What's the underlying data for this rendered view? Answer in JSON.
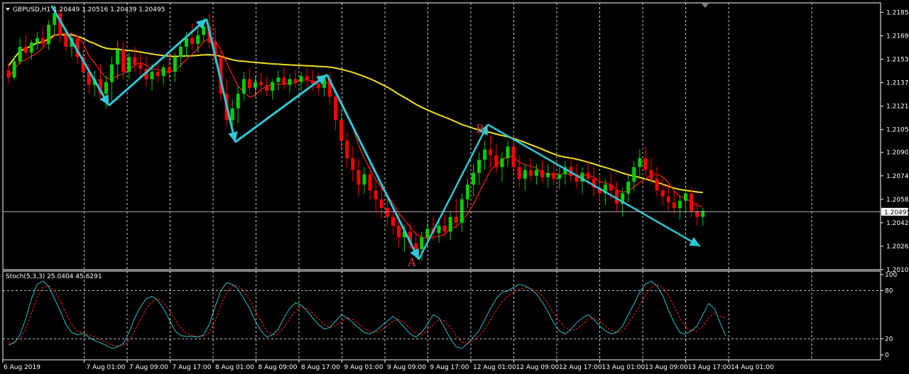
{
  "header": {
    "symbol_tf": "GBPUSD,H1",
    "ohlc": "1.20449 1.20516 1.20439 1.20495"
  },
  "stoch_header": {
    "label": "Stoch(5,3,3) 25.0404 45.6291"
  },
  "colors": {
    "background": "#000000",
    "grid": "#ffffff",
    "bull_candle": "#00d000",
    "bear_candle": "#ff0000",
    "fast_ma": "#ff2020",
    "slow_ma": "#f0e020",
    "arrows": "#2fc8d8",
    "stoch_main": "#30c0c8",
    "stoch_signal": "#ff2020",
    "price_line": "#b0b0b0"
  },
  "annotations": {
    "point_a": "A",
    "point_b": "B"
  },
  "chart_data": [
    {
      "type": "candlestick",
      "title": "",
      "price_axis_ticks": [
        "1.21855",
        "1.21695",
        "1.21535",
        "1.21375",
        "1.21215",
        "1.21055",
        "1.20900",
        "1.20740",
        "1.20580",
        "1.20420",
        "1.20260",
        "1.20100"
      ],
      "current_price": "1.20495",
      "ylim": [
        1.201,
        1.2192
      ],
      "time_axis_ticks": [
        "6 Aug 2019",
        "7 Aug 01:00",
        "7 Aug 09:00",
        "7 Aug 17:00",
        "8 Aug 01:00",
        "8 Aug 09:00",
        "8 Aug 17:00",
        "9 Aug 01:00",
        "9 Aug 09:00",
        "9 Aug 17:00",
        "12 Aug 01:00",
        "12 Aug 09:00",
        "12 Aug 17:00",
        "13 Aug 01:00",
        "13 Aug 09:00",
        "13 Aug 17:00",
        "14 Aug 01:00"
      ],
      "trend_arrows": [
        {
          "from": {
            "bar": 8,
            "price": 1.219
          },
          "to": {
            "bar": 18,
            "price": 1.2122
          }
        },
        {
          "from": {
            "bar": 18,
            "price": 1.2122
          },
          "to": {
            "bar": 35,
            "price": 1.2181
          }
        },
        {
          "from": {
            "bar": 35,
            "price": 1.2181
          },
          "to": {
            "bar": 40,
            "price": 1.2097
          }
        },
        {
          "from": {
            "bar": 40,
            "price": 1.2097
          },
          "to": {
            "bar": 56,
            "price": 1.2143
          }
        },
        {
          "from": {
            "bar": 56,
            "price": 1.2143
          },
          "to": {
            "bar": 72,
            "price": 1.2017
          }
        },
        {
          "from": {
            "bar": 72,
            "price": 1.2017
          },
          "to": {
            "bar": 84,
            "price": 1.2109
          }
        },
        {
          "from": {
            "bar": 84,
            "price": 1.2109
          },
          "to": {
            "bar": 121,
            "price": 1.2026
          }
        }
      ],
      "candles": [
        [
          1.2146,
          1.2151,
          1.2137,
          1.2141
        ],
        [
          1.2141,
          1.2156,
          1.2139,
          1.2152
        ],
        [
          1.2152,
          1.2168,
          1.215,
          1.2162
        ],
        [
          1.2162,
          1.217,
          1.2155,
          1.2158
        ],
        [
          1.2158,
          1.2167,
          1.2153,
          1.2165
        ],
        [
          1.2165,
          1.2172,
          1.216,
          1.2168
        ],
        [
          1.2168,
          1.2175,
          1.2162,
          1.2164
        ],
        [
          1.2164,
          1.218,
          1.216,
          1.2177
        ],
        [
          1.2177,
          1.219,
          1.217,
          1.2185
        ],
        [
          1.2185,
          1.2188,
          1.2165,
          1.217
        ],
        [
          1.217,
          1.2175,
          1.2158,
          1.2162
        ],
        [
          1.2162,
          1.2172,
          1.2155,
          1.2168
        ],
        [
          1.2168,
          1.217,
          1.215,
          1.2155
        ],
        [
          1.2155,
          1.216,
          1.214,
          1.2145
        ],
        [
          1.2145,
          1.215,
          1.213,
          1.2136
        ],
        [
          1.2136,
          1.2146,
          1.2128,
          1.214
        ],
        [
          1.214,
          1.215,
          1.2125,
          1.213
        ],
        [
          1.213,
          1.2142,
          1.212,
          1.2138
        ],
        [
          1.2138,
          1.2155,
          1.2125,
          1.215
        ],
        [
          1.215,
          1.2166,
          1.214,
          1.216
        ],
        [
          1.216,
          1.2165,
          1.214,
          1.2145
        ],
        [
          1.2145,
          1.2158,
          1.214,
          1.2155
        ],
        [
          1.2155,
          1.2162,
          1.2145,
          1.215
        ],
        [
          1.215,
          1.2158,
          1.2142,
          1.2147
        ],
        [
          1.2147,
          1.2155,
          1.2135,
          1.214
        ],
        [
          1.214,
          1.215,
          1.2132,
          1.2145
        ],
        [
          1.2145,
          1.2152,
          1.2138,
          1.2142
        ],
        [
          1.2142,
          1.215,
          1.2136,
          1.2148
        ],
        [
          1.2148,
          1.2158,
          1.214,
          1.2145
        ],
        [
          1.2145,
          1.2158,
          1.2138,
          1.2155
        ],
        [
          1.2155,
          1.2166,
          1.2148,
          1.2162
        ],
        [
          1.2162,
          1.2172,
          1.2155,
          1.2168
        ],
        [
          1.2168,
          1.2178,
          1.216,
          1.2164
        ],
        [
          1.2164,
          1.2175,
          1.2158,
          1.217
        ],
        [
          1.217,
          1.2182,
          1.2165,
          1.2176
        ],
        [
          1.2176,
          1.2185,
          1.2162,
          1.2165
        ],
        [
          1.2165,
          1.2175,
          1.215,
          1.2155
        ],
        [
          1.2155,
          1.216,
          1.2125,
          1.213
        ],
        [
          1.213,
          1.214,
          1.2108,
          1.2112
        ],
        [
          1.2112,
          1.2126,
          1.2102,
          1.212
        ],
        [
          1.212,
          1.2135,
          1.211,
          1.213
        ],
        [
          1.213,
          1.2145,
          1.2125,
          1.214
        ],
        [
          1.214,
          1.2147,
          1.213,
          1.2134
        ],
        [
          1.2134,
          1.2142,
          1.2128,
          1.2138
        ],
        [
          1.2138,
          1.2144,
          1.213,
          1.2136
        ],
        [
          1.2136,
          1.2142,
          1.2128,
          1.2132
        ],
        [
          1.2132,
          1.214,
          1.2126,
          1.2138
        ],
        [
          1.2138,
          1.2146,
          1.2132,
          1.2141
        ],
        [
          1.2141,
          1.2148,
          1.2133,
          1.2136
        ],
        [
          1.2136,
          1.2143,
          1.213,
          1.214
        ],
        [
          1.214,
          1.2146,
          1.2134,
          1.2138
        ],
        [
          1.2138,
          1.2145,
          1.2132,
          1.2142
        ],
        [
          1.2142,
          1.2148,
          1.2135,
          1.2139
        ],
        [
          1.2139,
          1.2146,
          1.2132,
          1.2137
        ],
        [
          1.2137,
          1.2144,
          1.213,
          1.2134
        ],
        [
          1.2134,
          1.2142,
          1.2128,
          1.214
        ],
        [
          1.214,
          1.2144,
          1.2122,
          1.2128
        ],
        [
          1.2128,
          1.2132,
          1.2105,
          1.2112
        ],
        [
          1.2112,
          1.2118,
          1.2092,
          1.2098
        ],
        [
          1.2098,
          1.2104,
          1.208,
          1.2086
        ],
        [
          1.2086,
          1.2094,
          1.207,
          1.2078
        ],
        [
          1.2078,
          1.2086,
          1.206,
          1.2068
        ],
        [
          1.2068,
          1.208,
          1.2062,
          1.2075
        ],
        [
          1.2075,
          1.2082,
          1.2058,
          1.2064
        ],
        [
          1.2064,
          1.2072,
          1.205,
          1.2058
        ],
        [
          1.2058,
          1.2066,
          1.2045,
          1.2052
        ],
        [
          1.2052,
          1.206,
          1.204,
          1.2046
        ],
        [
          1.2046,
          1.2054,
          1.2034,
          1.204
        ],
        [
          1.204,
          1.2048,
          1.2026,
          1.2032
        ],
        [
          1.2032,
          1.204,
          1.2022,
          1.2036
        ],
        [
          1.2036,
          1.2042,
          1.2024,
          1.2028
        ],
        [
          1.2028,
          1.2036,
          1.2018,
          1.2024
        ],
        [
          1.2024,
          1.2036,
          1.2016,
          1.2032
        ],
        [
          1.2032,
          1.2042,
          1.2026,
          1.2038
        ],
        [
          1.2038,
          1.2046,
          1.203,
          1.2035
        ],
        [
          1.2035,
          1.2044,
          1.2028,
          1.204
        ],
        [
          1.204,
          1.2048,
          1.2032,
          1.2036
        ],
        [
          1.2036,
          1.205,
          1.203,
          1.2046
        ],
        [
          1.2046,
          1.2058,
          1.2038,
          1.2042
        ],
        [
          1.2042,
          1.2062,
          1.2036,
          1.2058
        ],
        [
          1.2058,
          1.2072,
          1.2052,
          1.2068
        ],
        [
          1.2068,
          1.2082,
          1.206,
          1.2076
        ],
        [
          1.2076,
          1.209,
          1.2068,
          1.2085
        ],
        [
          1.2085,
          1.2098,
          1.2078,
          1.2092
        ],
        [
          1.2092,
          1.2102,
          1.208,
          1.2088
        ],
        [
          1.2088,
          1.2096,
          1.2076,
          1.208
        ],
        [
          1.208,
          1.209,
          1.207,
          1.2086
        ],
        [
          1.2086,
          1.2098,
          1.208,
          1.2094
        ],
        [
          1.2094,
          1.2102,
          1.2076,
          1.208
        ],
        [
          1.208,
          1.2088,
          1.2066,
          1.2072
        ],
        [
          1.2072,
          1.2082,
          1.2064,
          1.2078
        ],
        [
          1.2078,
          1.2086,
          1.207,
          1.2074
        ],
        [
          1.2074,
          1.2082,
          1.2068,
          1.2078
        ],
        [
          1.2078,
          1.2084,
          1.207,
          1.2073
        ],
        [
          1.2073,
          1.2082,
          1.2066,
          1.2076
        ],
        [
          1.2076,
          1.2084,
          1.2068,
          1.2072
        ],
        [
          1.2072,
          1.208,
          1.2065,
          1.2075
        ],
        [
          1.2075,
          1.2084,
          1.2068,
          1.208
        ],
        [
          1.208,
          1.2086,
          1.207,
          1.2074
        ],
        [
          1.2074,
          1.2082,
          1.2066,
          1.207
        ],
        [
          1.207,
          1.208,
          1.2062,
          1.2076
        ],
        [
          1.2076,
          1.2084,
          1.2068,
          1.2072
        ],
        [
          1.2072,
          1.208,
          1.206,
          1.2066
        ],
        [
          1.2066,
          1.2074,
          1.2056,
          1.2062
        ],
        [
          1.2062,
          1.2072,
          1.2054,
          1.2068
        ],
        [
          1.2068,
          1.2076,
          1.2058,
          1.2064
        ],
        [
          1.2064,
          1.207,
          1.205,
          1.2055
        ],
        [
          1.2055,
          1.2066,
          1.2046,
          1.2062
        ],
        [
          1.2062,
          1.2074,
          1.2056,
          1.207
        ],
        [
          1.207,
          1.2084,
          1.2064,
          1.208
        ],
        [
          1.208,
          1.2092,
          1.2072,
          1.2086
        ],
        [
          1.2086,
          1.2094,
          1.2074,
          1.2078
        ],
        [
          1.2078,
          1.2086,
          1.2068,
          1.2072
        ],
        [
          1.2072,
          1.208,
          1.206,
          1.2064
        ],
        [
          1.2064,
          1.2072,
          1.2054,
          1.206
        ],
        [
          1.206,
          1.2068,
          1.205,
          1.2056
        ],
        [
          1.2056,
          1.2064,
          1.2048,
          1.2052
        ],
        [
          1.2052,
          1.206,
          1.2044,
          1.2057
        ],
        [
          1.2057,
          1.2064,
          1.2048,
          1.2062
        ],
        [
          1.2062,
          1.2066,
          1.2046,
          1.205
        ],
        [
          1.205,
          1.2056,
          1.204,
          1.2046
        ],
        [
          1.2046,
          1.2052,
          1.204,
          1.205
        ]
      ]
    },
    {
      "type": "line",
      "title": "",
      "ylim": [
        0,
        100
      ],
      "y_ticks": [
        "100",
        "80",
        "20",
        "0"
      ],
      "levels": [
        80,
        20
      ],
      "series": [
        {
          "values": [
            12,
            15,
            25,
            45,
            70,
            88,
            92,
            85,
            70,
            55,
            38,
            28,
            25,
            27,
            22,
            18,
            15,
            12,
            8,
            10,
            14,
            28,
            46,
            60,
            70,
            73,
            68,
            58,
            44,
            30,
            24,
            23,
            23,
            22,
            25,
            38,
            60,
            80,
            90,
            88,
            82,
            70,
            58,
            42,
            30,
            22,
            25,
            32,
            46,
            58,
            65,
            62,
            55,
            46,
            38,
            32,
            34,
            42,
            50,
            46,
            40,
            34,
            28,
            26,
            30,
            36,
            42,
            48,
            42,
            34,
            26,
            22,
            28,
            38,
            50,
            46,
            34,
            20,
            10,
            8,
            14,
            22,
            30,
            44,
            58,
            70,
            78,
            80,
            84,
            88,
            86,
            82,
            76,
            66,
            54,
            40,
            30,
            26,
            32,
            40,
            46,
            50,
            44,
            36,
            30,
            26,
            28,
            36,
            50,
            64,
            78,
            88,
            92,
            86,
            74,
            56,
            40,
            28,
            26,
            30,
            36,
            50,
            64,
            58,
            40,
            24
          ]
        },
        {
          "values": [
            14,
            16,
            20,
            32,
            52,
            72,
            84,
            86,
            80,
            68,
            52,
            38,
            30,
            27,
            25,
            22,
            19,
            16,
            12,
            11,
            12,
            18,
            30,
            44,
            58,
            66,
            70,
            65,
            56,
            44,
            33,
            27,
            24,
            23,
            23,
            28,
            42,
            62,
            78,
            86,
            86,
            80,
            68,
            55,
            42,
            30,
            25,
            26,
            34,
            45,
            55,
            60,
            58,
            52,
            45,
            38,
            34,
            36,
            42,
            46,
            44,
            39,
            33,
            29,
            28,
            31,
            36,
            42,
            44,
            40,
            33,
            27,
            25,
            30,
            38,
            44,
            42,
            34,
            24,
            16,
            14,
            18,
            24,
            32,
            44,
            56,
            66,
            74,
            78,
            82,
            84,
            83,
            80,
            74,
            64,
            52,
            42,
            34,
            30,
            32,
            38,
            44,
            46,
            42,
            36,
            31,
            28,
            30,
            38,
            50,
            62,
            74,
            84,
            88,
            84,
            74,
            60,
            46,
            34,
            30,
            30,
            36,
            46,
            52,
            48,
            46
          ]
        }
      ]
    }
  ]
}
